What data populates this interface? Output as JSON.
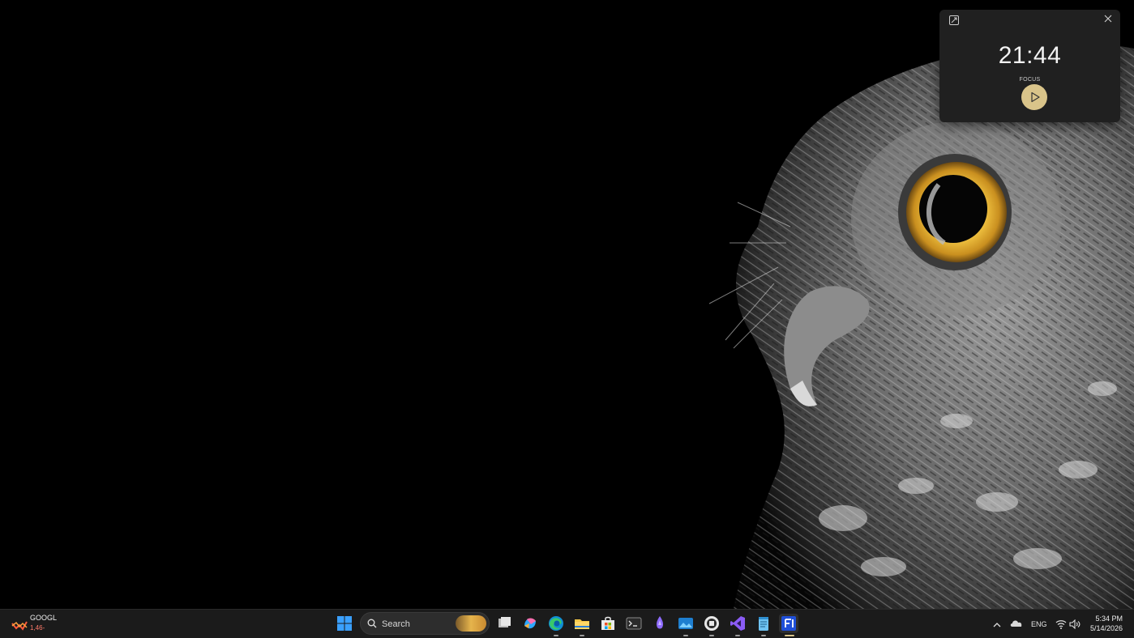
{
  "timer": {
    "time": "21:44",
    "mode": "FOCUS",
    "expand_icon": "expand-icon",
    "close_icon": "close-icon",
    "play_icon": "play-icon",
    "accent": "#d9c48a"
  },
  "taskbar": {
    "weather": {
      "symbol": "GOOGL",
      "change": "‎1,46-"
    },
    "search": {
      "label": "Search"
    },
    "apps": [
      "start-icon",
      "task-view-icon",
      "copilot-icon",
      "edge-icon",
      "file-explorer-icon",
      "store-icon",
      "terminal-icon",
      "app-purple-icon",
      "photos-icon",
      "app-circle-icon",
      "visual-studio-icon",
      "notepad-icon",
      "app-fi-icon"
    ],
    "tray": {
      "language": "ENG"
    },
    "clock": {
      "time": "5:34 PM",
      "date": "5/14/2026"
    }
  }
}
